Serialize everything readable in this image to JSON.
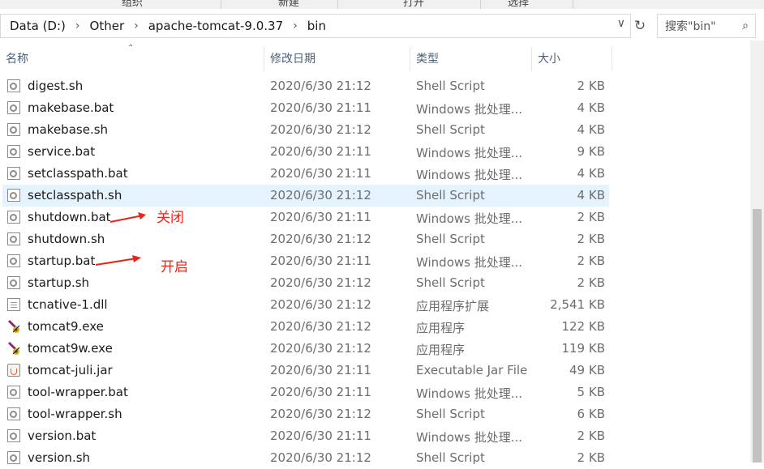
{
  "ribbon": {
    "tabs": [
      "组织",
      "新建",
      "打开",
      "选择"
    ]
  },
  "address": {
    "crumbs": [
      "Data (D:)",
      "Other",
      "apache-tomcat-9.0.37",
      "bin"
    ]
  },
  "search": {
    "placeholder": "搜索\"bin\""
  },
  "columns": {
    "name": "名称",
    "date": "修改日期",
    "type": "类型",
    "size": "大小"
  },
  "files": [
    {
      "name": "digest.sh",
      "date": "2020/6/30 21:12",
      "type": "Shell Script",
      "size": "2 KB",
      "icon": "script-file-icon"
    },
    {
      "name": "makebase.bat",
      "date": "2020/6/30 21:11",
      "type": "Windows 批处理...",
      "size": "4 KB",
      "icon": "script-file-icon"
    },
    {
      "name": "makebase.sh",
      "date": "2020/6/30 21:12",
      "type": "Shell Script",
      "size": "4 KB",
      "icon": "script-file-icon"
    },
    {
      "name": "service.bat",
      "date": "2020/6/30 21:11",
      "type": "Windows 批处理...",
      "size": "9 KB",
      "icon": "script-file-icon"
    },
    {
      "name": "setclasspath.bat",
      "date": "2020/6/30 21:11",
      "type": "Windows 批处理...",
      "size": "4 KB",
      "icon": "script-file-icon"
    },
    {
      "name": "setclasspath.sh",
      "date": "2020/6/30 21:12",
      "type": "Shell Script",
      "size": "4 KB",
      "icon": "script-file-icon",
      "selected": true
    },
    {
      "name": "shutdown.bat",
      "date": "2020/6/30 21:11",
      "type": "Windows 批处理...",
      "size": "2 KB",
      "icon": "script-file-icon"
    },
    {
      "name": "shutdown.sh",
      "date": "2020/6/30 21:12",
      "type": "Shell Script",
      "size": "2 KB",
      "icon": "script-file-icon"
    },
    {
      "name": "startup.bat",
      "date": "2020/6/30 21:11",
      "type": "Windows 批处理...",
      "size": "2 KB",
      "icon": "script-file-icon"
    },
    {
      "name": "startup.sh",
      "date": "2020/6/30 21:12",
      "type": "Shell Script",
      "size": "2 KB",
      "icon": "script-file-icon"
    },
    {
      "name": "tcnative-1.dll",
      "date": "2020/6/30 21:12",
      "type": "应用程序扩展",
      "size": "2,541 KB",
      "icon": "dll-file-icon"
    },
    {
      "name": "tomcat9.exe",
      "date": "2020/6/30 21:12",
      "type": "应用程序",
      "size": "122 KB",
      "icon": "tomcat-exe-icon"
    },
    {
      "name": "tomcat9w.exe",
      "date": "2020/6/30 21:12",
      "type": "应用程序",
      "size": "119 KB",
      "icon": "tomcat-exe-icon"
    },
    {
      "name": "tomcat-juli.jar",
      "date": "2020/6/30 21:11",
      "type": "Executable Jar File",
      "size": "49 KB",
      "icon": "jar-file-icon"
    },
    {
      "name": "tool-wrapper.bat",
      "date": "2020/6/30 21:11",
      "type": "Windows 批处理...",
      "size": "5 KB",
      "icon": "script-file-icon"
    },
    {
      "name": "tool-wrapper.sh",
      "date": "2020/6/30 21:12",
      "type": "Shell Script",
      "size": "6 KB",
      "icon": "script-file-icon"
    },
    {
      "name": "version.bat",
      "date": "2020/6/30 21:11",
      "type": "Windows 批处理...",
      "size": "2 KB",
      "icon": "script-file-icon"
    },
    {
      "name": "version.sh",
      "date": "2020/6/30 21:12",
      "type": "Shell Script",
      "size": "2 KB",
      "icon": "script-file-icon"
    }
  ],
  "annotations": {
    "shutdown": "关闭",
    "startup": "开启",
    "color": "#e8251b"
  },
  "colors": {
    "selection": "#e5f3ff",
    "header_text": "#4c607a"
  }
}
